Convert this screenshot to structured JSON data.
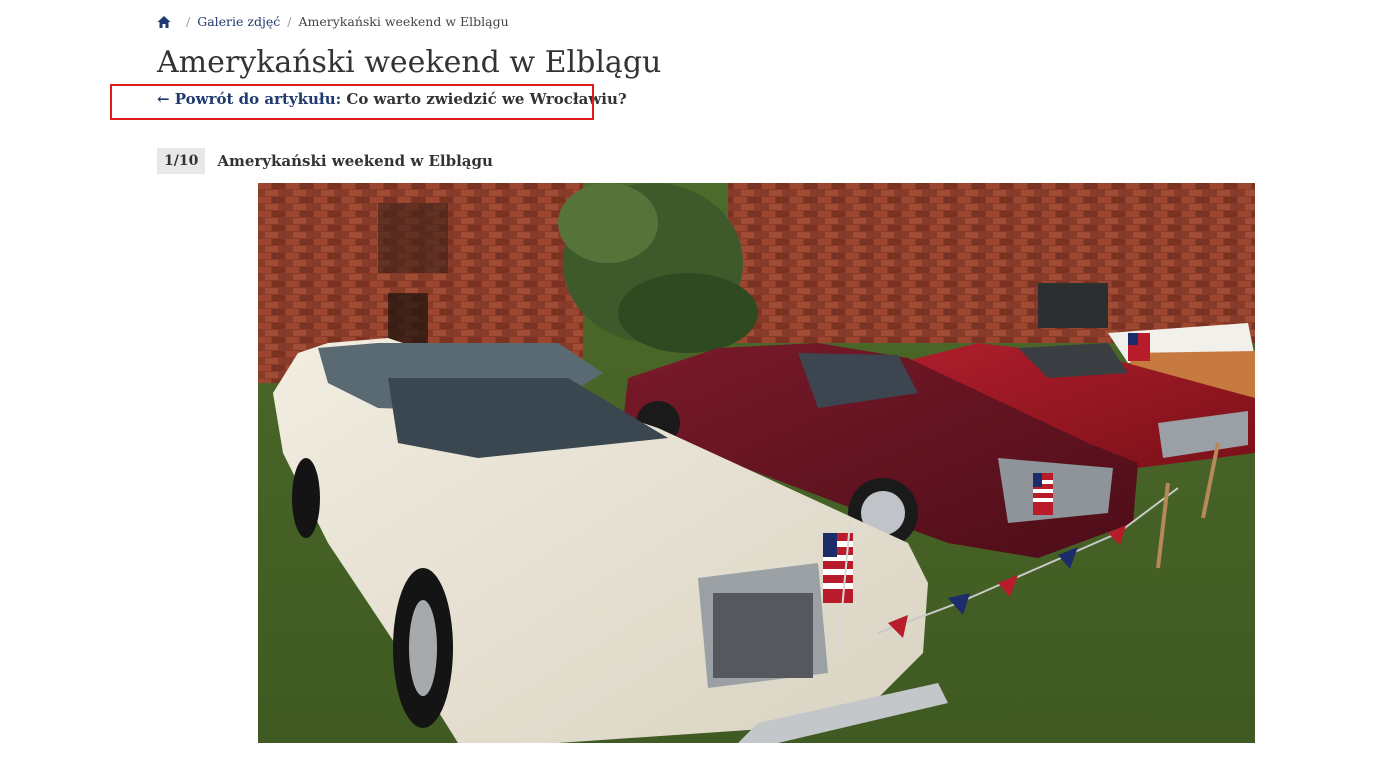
{
  "breadcrumb": {
    "home_icon": "home-icon",
    "items": [
      "Galerie zdjęć"
    ],
    "current": "Amerykański weekend w Elblągu"
  },
  "page": {
    "title": "Amerykański weekend w Elblągu"
  },
  "back_link": {
    "lead": "← Powrót do artykułu:",
    "article": "Co warto zwiedzić we Wrocławiu?"
  },
  "gallery": {
    "counter": "1/10",
    "slide_title": "Amerykański weekend w Elblągu",
    "image_alt": "Amerykański weekend w Elblągu"
  },
  "colors": {
    "link": "#1f3a6e",
    "highlight": "#e01b1b",
    "counter_bg": "#e8e8e8"
  }
}
